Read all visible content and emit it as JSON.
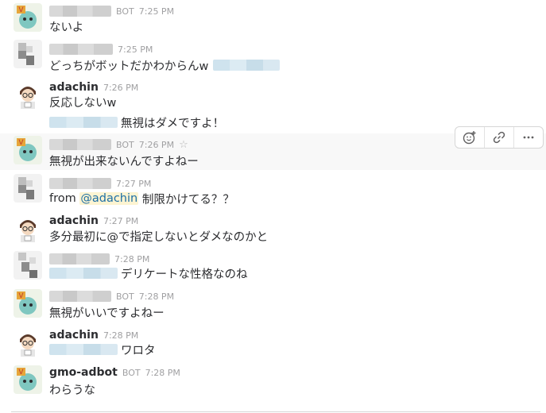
{
  "colors": {
    "mention_bg": "#fdf4d2",
    "mention_text": "#1d6fa5",
    "meta_gray": "#a0a0a2",
    "hover_bg": "#f8f8f8"
  },
  "messages": [
    {
      "avatar": "robot-avatar",
      "name": "",
      "bot": "BOT",
      "time": "7:25 PM",
      "text": "ないよ"
    },
    {
      "avatar": "pixel-avatar",
      "name": "",
      "time": "7:25 PM",
      "text": "どっちがボットだかわからんw"
    },
    {
      "avatar": "person-avatar",
      "name": "adachin",
      "time": "7:26 PM",
      "text": "反応しないw",
      "text2": "無視はダメですよ！"
    },
    {
      "avatar": "robot-avatar",
      "name": "",
      "bot": "BOT",
      "time": "7:26 PM",
      "text": "無視が出来ないんですよねー"
    },
    {
      "avatar": "pixel-avatar",
      "name": "",
      "time": "7:27 PM",
      "text_prefix": "from ",
      "mention": "@adachin",
      "text_suffix": " 制限かけてる？？"
    },
    {
      "avatar": "person-avatar",
      "name": "adachin",
      "time": "7:27 PM",
      "text": "多分最初に@で指定しないとダメなのかと"
    },
    {
      "avatar": "pixel-avatar",
      "name": "",
      "time": "7:28 PM",
      "text": "デリケートな性格なのね"
    },
    {
      "avatar": "robot-avatar",
      "name": "",
      "bot": "BOT",
      "time": "7:28 PM",
      "text": "無視がいいですよねー"
    },
    {
      "avatar": "person-avatar",
      "name": "adachin",
      "time": "7:28 PM",
      "text": "ワロタ"
    },
    {
      "avatar": "robot-avatar",
      "name": "gmo-adbot",
      "bot": "BOT",
      "time": "7:28 PM",
      "text": "わらうな"
    }
  ],
  "hover_actions": [
    {
      "icon": "add-reaction-icon",
      "glyph": "☺"
    },
    {
      "icon": "link-icon",
      "glyph": "🔗"
    },
    {
      "icon": "more-icon",
      "glyph": "···"
    }
  ],
  "star_icon": "star-icon",
  "star_glyph": "☆"
}
